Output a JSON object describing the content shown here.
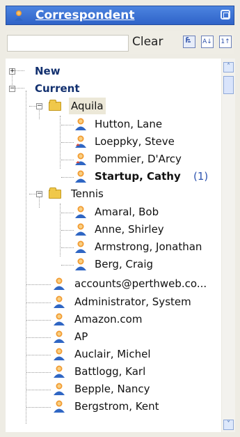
{
  "window": {
    "title": "Correspondent"
  },
  "toolbar": {
    "search_value": "",
    "clear_label": "Clear",
    "view_buttons": [
      "tree",
      "A↓",
      "1↑"
    ]
  },
  "tree": {
    "groups": [
      {
        "label": "New",
        "expanded": false
      },
      {
        "label": "Current",
        "expanded": true
      }
    ],
    "folders": [
      {
        "label": "Aquila",
        "items": [
          "Hutton, Lane",
          "Loeppky, Steve",
          "Pommier, D'Arcy",
          "Startup, Cathy"
        ],
        "bold_item": "Startup, Cathy",
        "badge": "(1)"
      },
      {
        "label": "Tennis",
        "items": [
          "Amaral, Bob",
          "Anne, Shirley",
          "Armstrong, Jonathan",
          "Berg, Craig"
        ]
      }
    ],
    "contacts": [
      "accounts@perthweb.co...",
      "Administrator, System",
      "Amazon.com",
      "AP",
      "Auclair, Michel",
      "Battlogg, Karl",
      "Bepple, Nancy",
      "Bergstrom, Kent"
    ]
  },
  "colors": {
    "title_bar": "#2f63c8",
    "group_text": "#12306f",
    "folder": "#f0c84a",
    "badge": "#2f55b0"
  }
}
